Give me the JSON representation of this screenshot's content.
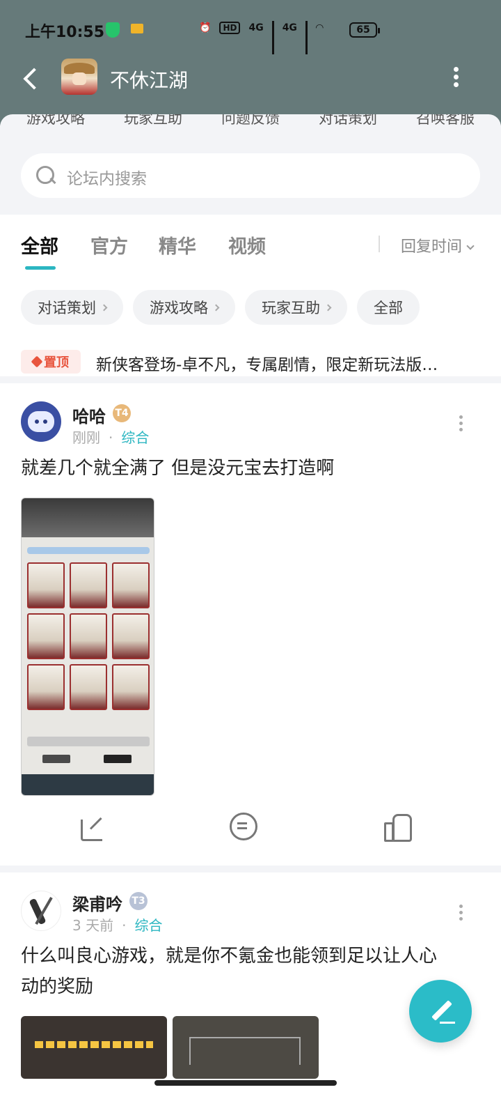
{
  "status_bar": {
    "time": "上午10:55",
    "network1": "4G",
    "network2": "4G",
    "hd": "HD",
    "battery": "65"
  },
  "header": {
    "title": "不休江湖"
  },
  "categories": [
    "游戏攻略",
    "玩家互助",
    "问题反馈",
    "对话策划",
    "召唤客服"
  ],
  "search": {
    "placeholder": "论坛内搜索"
  },
  "tabs": [
    "全部",
    "官方",
    "精华",
    "视频"
  ],
  "sort": "回复时间",
  "chips": [
    "对话策划",
    "游戏攻略",
    "玩家互助",
    "全部"
  ],
  "pinned": {
    "badge": "置顶",
    "text": "新侠客登场-卓不凡，专属剧情，限定新玩法版…"
  },
  "posts": [
    {
      "username": "哈哈",
      "level": "T4",
      "time": "刚刚",
      "category": "综合",
      "content": "就差几个就全满了  但是没元宝去打造啊"
    },
    {
      "username": "梁甫吟",
      "level": "T3",
      "time": "3 天前",
      "category": "综合",
      "content": "什么叫良心游戏，就是你不氪金也能领到足以让人心动的奖励"
    }
  ],
  "colors": {
    "accent": "#2bb6c1",
    "header_bg": "#667a7a",
    "pin": "#e8553e"
  }
}
